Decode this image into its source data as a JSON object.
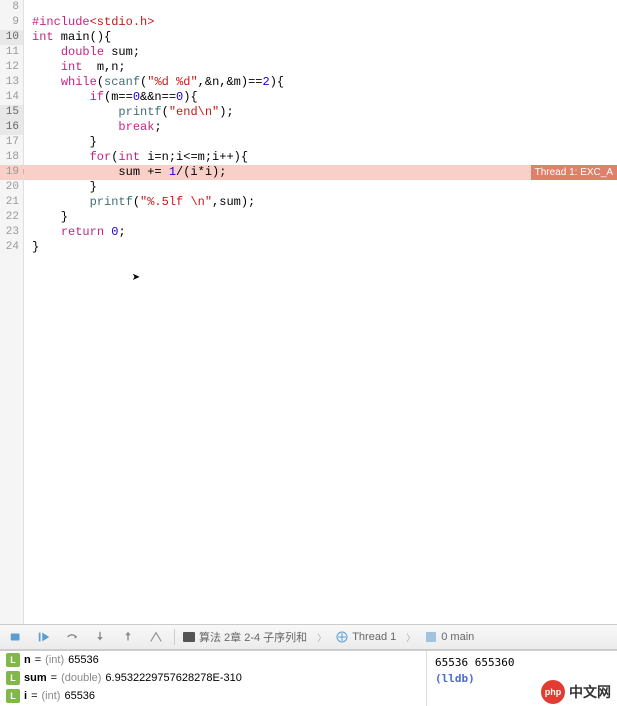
{
  "lines": [
    {
      "num": "8",
      "hl": false,
      "tokens": []
    },
    {
      "num": "9",
      "hl": false,
      "tokens": [
        {
          "t": "#include",
          "c": "kw-pink"
        },
        {
          "t": "<stdio.h>",
          "c": "str-red"
        }
      ]
    },
    {
      "num": "10",
      "hl": true,
      "tokens": [
        {
          "t": "int",
          "c": "kw-pink"
        },
        {
          "t": " main(){",
          "c": "plain"
        }
      ]
    },
    {
      "num": "11",
      "hl": false,
      "tokens": [
        {
          "t": "    ",
          "c": "plain"
        },
        {
          "t": "double",
          "c": "kw-pink"
        },
        {
          "t": " sum;",
          "c": "plain"
        }
      ]
    },
    {
      "num": "12",
      "hl": false,
      "tokens": [
        {
          "t": "    ",
          "c": "plain"
        },
        {
          "t": "int",
          "c": "kw-pink"
        },
        {
          "t": "  m,n;",
          "c": "plain"
        }
      ]
    },
    {
      "num": "13",
      "hl": false,
      "tokens": [
        {
          "t": "    ",
          "c": "plain"
        },
        {
          "t": "while",
          "c": "kw-pink"
        },
        {
          "t": "(",
          "c": "plain"
        },
        {
          "t": "scanf",
          "c": "fn-teal"
        },
        {
          "t": "(",
          "c": "plain"
        },
        {
          "t": "\"%d %d\"",
          "c": "str-red"
        },
        {
          "t": ",&n,&m)==",
          "c": "plain"
        },
        {
          "t": "2",
          "c": "num-blue"
        },
        {
          "t": "){",
          "c": "plain"
        }
      ]
    },
    {
      "num": "14",
      "hl": false,
      "tokens": [
        {
          "t": "        ",
          "c": "plain"
        },
        {
          "t": "if",
          "c": "kw-pink"
        },
        {
          "t": "(m==",
          "c": "plain"
        },
        {
          "t": "0",
          "c": "num-blue"
        },
        {
          "t": "&&n==",
          "c": "plain"
        },
        {
          "t": "0",
          "c": "num-blue"
        },
        {
          "t": "){",
          "c": "plain"
        }
      ]
    },
    {
      "num": "15",
      "hl": true,
      "tokens": [
        {
          "t": "            ",
          "c": "plain"
        },
        {
          "t": "printf",
          "c": "fn-teal"
        },
        {
          "t": "(",
          "c": "plain"
        },
        {
          "t": "\"end\\n\"",
          "c": "str-red"
        },
        {
          "t": ");",
          "c": "plain"
        }
      ]
    },
    {
      "num": "16",
      "hl": true,
      "tokens": [
        {
          "t": "            ",
          "c": "plain"
        },
        {
          "t": "break",
          "c": "kw-pink"
        },
        {
          "t": ";",
          "c": "plain"
        }
      ]
    },
    {
      "num": "17",
      "hl": false,
      "tokens": [
        {
          "t": "        }",
          "c": "plain"
        }
      ]
    },
    {
      "num": "18",
      "hl": false,
      "tokens": [
        {
          "t": "        ",
          "c": "plain"
        },
        {
          "t": "for",
          "c": "kw-pink"
        },
        {
          "t": "(",
          "c": "plain"
        },
        {
          "t": "int",
          "c": "kw-pink"
        },
        {
          "t": " i=n;i<=m;i++){",
          "c": "plain"
        }
      ]
    },
    {
      "num": "19",
      "hl": false,
      "err": true,
      "tokens": [
        {
          "t": "            sum += ",
          "c": "plain"
        },
        {
          "t": "1",
          "c": "num-blue"
        },
        {
          "t": "/(i*i);",
          "c": "plain"
        }
      ]
    },
    {
      "num": "20",
      "hl": false,
      "tokens": [
        {
          "t": "        }",
          "c": "plain"
        }
      ]
    },
    {
      "num": "21",
      "hl": false,
      "tokens": [
        {
          "t": "        ",
          "c": "plain"
        },
        {
          "t": "printf",
          "c": "fn-teal"
        },
        {
          "t": "(",
          "c": "plain"
        },
        {
          "t": "\"%.5lf \\n\"",
          "c": "str-red"
        },
        {
          "t": ",sum);",
          "c": "plain"
        }
      ]
    },
    {
      "num": "22",
      "hl": false,
      "tokens": [
        {
          "t": "    }",
          "c": "plain"
        }
      ]
    },
    {
      "num": "23",
      "hl": false,
      "tokens": [
        {
          "t": "    ",
          "c": "plain"
        },
        {
          "t": "return",
          "c": "kw-pink"
        },
        {
          "t": " ",
          "c": "plain"
        },
        {
          "t": "0",
          "c": "num-blue"
        },
        {
          "t": ";",
          "c": "plain"
        }
      ]
    },
    {
      "num": "24",
      "hl": false,
      "tokens": [
        {
          "t": "}",
          "c": "plain"
        }
      ]
    }
  ],
  "error_badge": "Thread 1: EXC_A",
  "debug_breadcrumb": {
    "file": "算法 2章 2-4 子序列和",
    "thread": "Thread 1",
    "frame": "0 main"
  },
  "variables": [
    {
      "name": "n",
      "type": "(int)",
      "value": "65536"
    },
    {
      "name": "sum",
      "type": "(double)",
      "value": "6.9532229757628278E-310"
    },
    {
      "name": "i",
      "type": "(int)",
      "value": "65536"
    }
  ],
  "console": {
    "output": "65536  655360",
    "prompt": "(lldb)"
  },
  "watermark": {
    "badge": "php",
    "text": "中文网"
  }
}
